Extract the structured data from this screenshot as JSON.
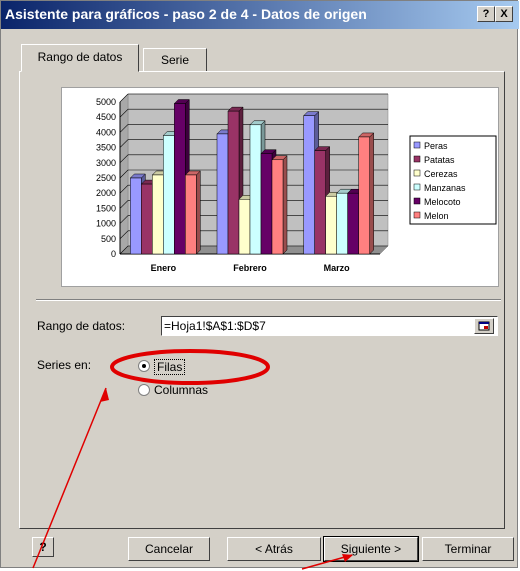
{
  "window": {
    "title": "Asistente para gráficos - paso 2 de 4 - Datos de origen",
    "help_label": "?",
    "close_label": "X"
  },
  "tabs": [
    {
      "label": "Rango de datos"
    },
    {
      "label": "Serie"
    }
  ],
  "chart_data": {
    "type": "bar",
    "categories": [
      "Enero",
      "Febrero",
      "Marzo"
    ],
    "series": [
      {
        "name": "Peras",
        "values": [
          2500,
          3950,
          4550
        ],
        "color": "#9999ff"
      },
      {
        "name": "Patatas",
        "values": [
          2300,
          4700,
          3400
        ],
        "color": "#993366"
      },
      {
        "name": "Cerezas",
        "values": [
          2600,
          1800,
          1900
        ],
        "color": "#ffffcc"
      },
      {
        "name": "Manzanas",
        "values": [
          3900,
          4250,
          2000
        ],
        "color": "#ccffff"
      },
      {
        "name": "Melocoto",
        "values": [
          4950,
          3300,
          2000
        ],
        "color": "#660066"
      },
      {
        "name": "Melon",
        "values": [
          2600,
          3100,
          3850
        ],
        "color": "#ff8080"
      }
    ],
    "yticks": [
      "0",
      "500",
      "1000",
      "1500",
      "2000",
      "2500",
      "3000",
      "3500",
      "4000",
      "4500",
      "5000"
    ],
    "ylim": [
      0,
      5000
    ],
    "grid": true,
    "legend": "right"
  },
  "form": {
    "range_label": "Rango de datos:",
    "range_value": "=Hoja1!$A$1:$D$7",
    "series_label": "Series en:",
    "series_options": [
      {
        "label": "Filas",
        "selected": true
      },
      {
        "label": "Columnas",
        "selected": false
      }
    ]
  },
  "buttons": {
    "help": "?",
    "cancel": "Cancelar",
    "back": "< Atrás",
    "next": "Siguiente >",
    "finish": "Terminar"
  },
  "colors": {
    "titlebar_start": "#0a246a",
    "annotation": "#e00000"
  }
}
